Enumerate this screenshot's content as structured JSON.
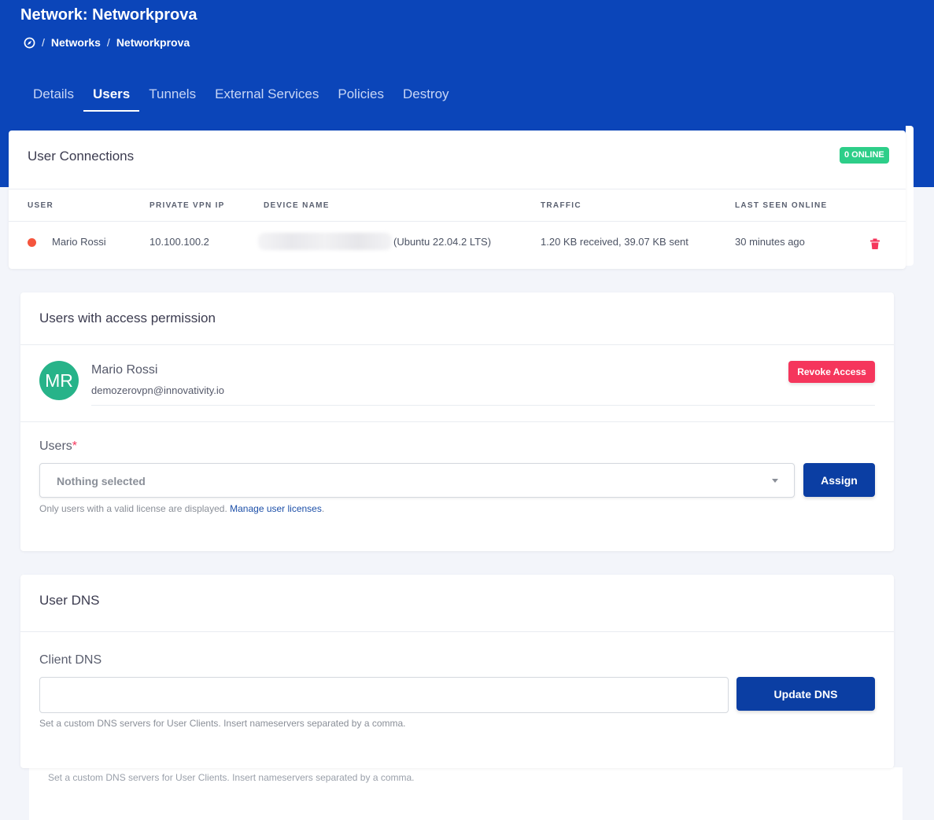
{
  "header": {
    "title": "Network: Networkprova",
    "breadcrumb": [
      "Networks",
      "Networkprova"
    ]
  },
  "tabs": [
    {
      "label": "Details",
      "active": false
    },
    {
      "label": "Users",
      "active": true
    },
    {
      "label": "Tunnels",
      "active": false
    },
    {
      "label": "External Services",
      "active": false
    },
    {
      "label": "Policies",
      "active": false
    },
    {
      "label": "Destroy",
      "active": false
    }
  ],
  "connections": {
    "title": "User Connections",
    "badge": "0 ONLINE",
    "columns": [
      "USER",
      "PRIVATE VPN IP",
      "DEVICE NAME",
      "TRAFFIC",
      "LAST SEEN ONLINE"
    ],
    "rows": [
      {
        "user": "Mario Rossi",
        "ip": "10.100.100.2",
        "device_os": "(Ubuntu 22.04.2 LTS)",
        "traffic": "1.20 KB received, 39.07 KB sent",
        "last_seen": "30 minutes ago",
        "status_color": "#f5553d"
      }
    ]
  },
  "permissions": {
    "title": "Users with access permission",
    "users": [
      {
        "initials": "MR",
        "name": "Mario Rossi",
        "email": "demozerovpn@innovativity.io",
        "revoke_label": "Revoke Access"
      }
    ],
    "users_label": "Users",
    "required_mark": "*",
    "select_value": "Nothing selected",
    "assign_label": "Assign",
    "help_text": "Only users with a valid license are displayed.",
    "help_link": "Manage user licenses",
    "help_suffix": "."
  },
  "dns": {
    "title": "User DNS",
    "field_label": "Client DNS",
    "value": "",
    "button_label": "Update DNS",
    "help_text": "Set a custom DNS servers for User Clients. Insert nameservers separated by a comma."
  },
  "colors": {
    "header_blue": "#0b45b9",
    "primary_button": "#0b3ea3",
    "danger": "#f5365c",
    "success": "#2dce89",
    "avatar": "#27b389"
  }
}
